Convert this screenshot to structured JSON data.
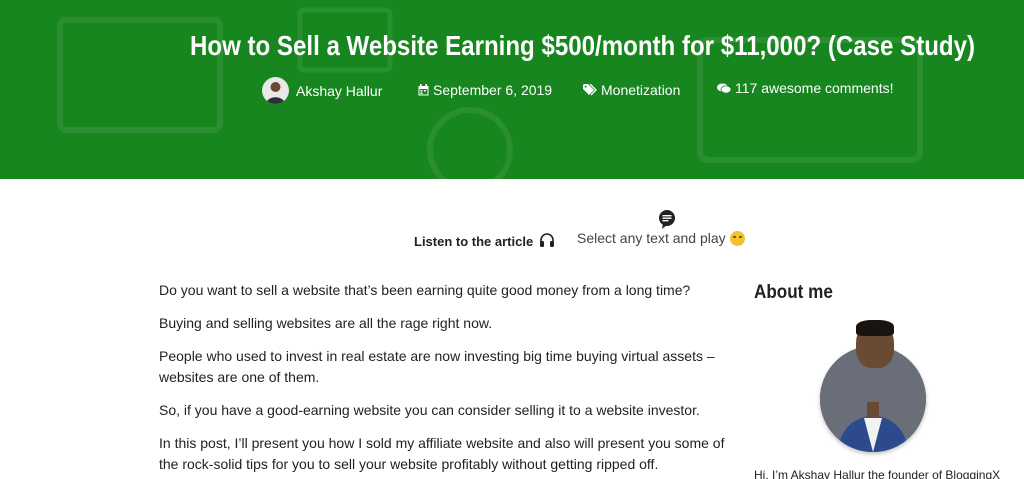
{
  "hero": {
    "title": "How to Sell a Website Earning $500/month for $11,000? (Case Study)",
    "author": "Akshay Hallur",
    "date": "September 6, 2019",
    "category": "Monetization",
    "comments": "117 awesome comments!",
    "background_color": "#17861f"
  },
  "listen": {
    "label": "Listen to the article",
    "hint": "Select any text and play"
  },
  "article": {
    "paragraphs": [
      "Do you want to sell a website that’s been earning quite good money from a long time?",
      "Buying and selling websites are all the rage right now.",
      "People who used to invest in real estate are now investing big time buying virtual assets – websites are one of them.",
      "So, if you have a good-earning website you can consider selling it to a website investor.",
      "In this post, I’ll present you how I sold my affiliate website and also will present you some of the rock-solid tips for you to sell your website profitably without getting ripped off."
    ]
  },
  "sidebar": {
    "title": "About me",
    "intro": "Hi, I’m Akshay Hallur the founder of BloggingX"
  },
  "icons": {
    "calendar": "calendar-icon",
    "tag": "tag-icon",
    "comments": "comments-icon",
    "headphones": "headphones-icon",
    "chat": "chat-bubble-icon",
    "emoji": "smirk-emoji-icon"
  }
}
